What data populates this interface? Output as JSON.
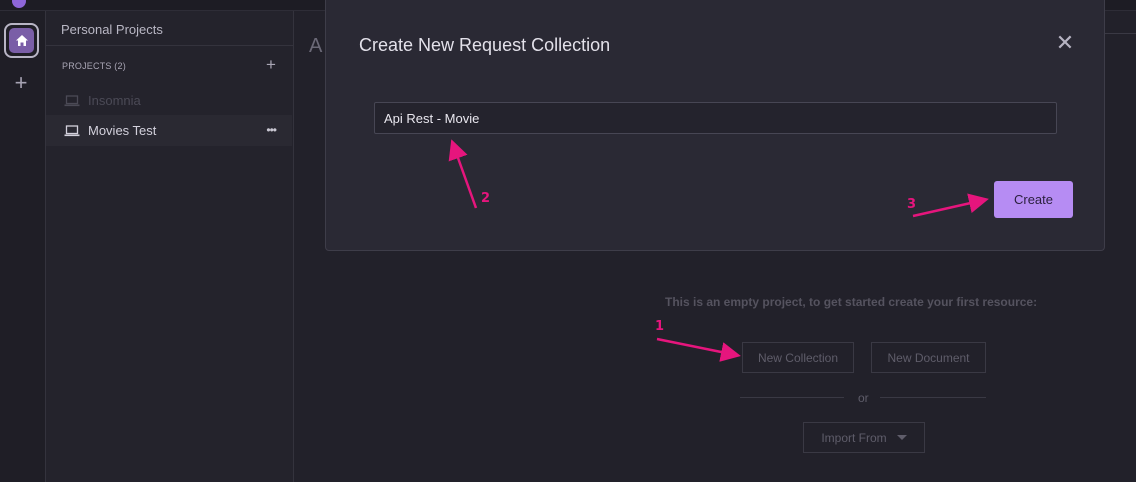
{
  "app": {
    "sidebar": {
      "title": "Personal Projects",
      "projects_label": "PROJECTS (2)",
      "items": [
        {
          "label": "Insomnia",
          "state": "dim"
        },
        {
          "label": "Movies Test",
          "state": "active",
          "more": "•••"
        }
      ]
    },
    "main": {
      "header_letter": "A",
      "empty_message": "This is an empty project, to get started create your first resource:",
      "buttons": {
        "new_collection": "New Collection",
        "new_document": "New Document",
        "or": "or",
        "import_from": "Import From"
      }
    }
  },
  "modal": {
    "title": "Create New Request Collection",
    "close_glyph": "✕",
    "input_value": "Api Rest - Movie",
    "create_label": "Create"
  },
  "annotations": {
    "color": "#e6157d",
    "labels": [
      "1",
      "2",
      "3"
    ]
  },
  "colors": {
    "accent": "#b68cf3",
    "home_icon_bg": "#7a5ea7",
    "background": "#22212a"
  }
}
